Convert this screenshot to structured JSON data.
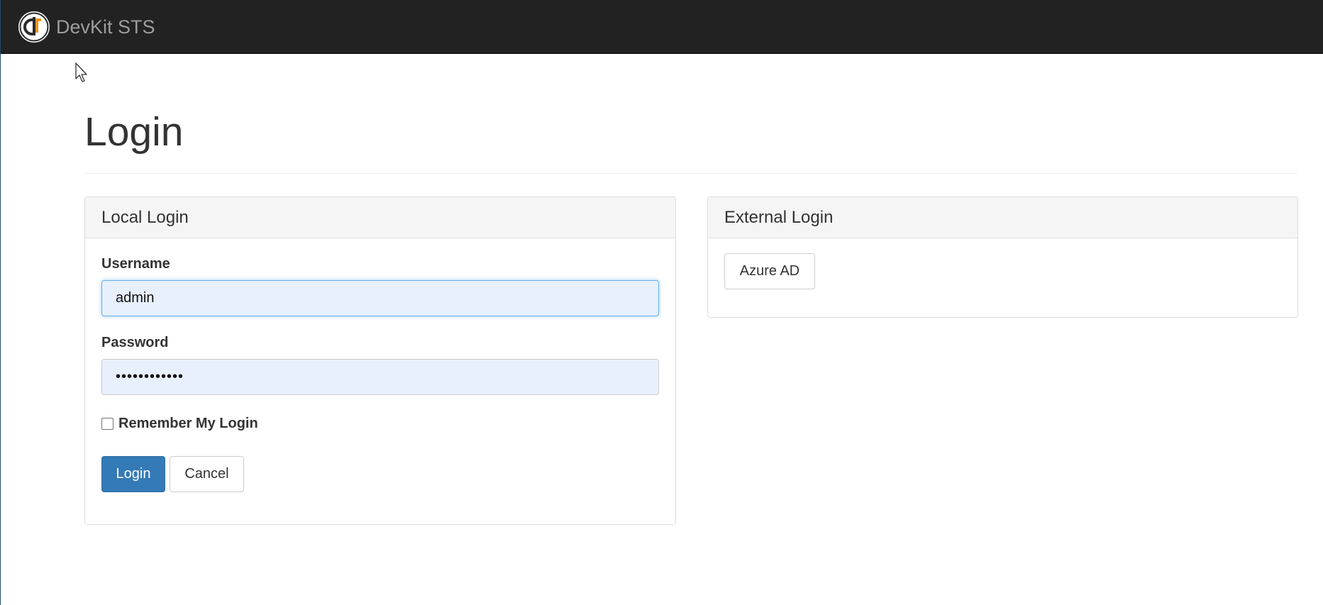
{
  "navbar": {
    "brand_name": "DevKit STS",
    "logo_icon": "devkit-logo-icon",
    "background": "#222222",
    "brand_color": "#9d9d9d"
  },
  "page": {
    "title": "Login"
  },
  "local_login": {
    "heading": "Local Login",
    "username_label": "Username",
    "username_value": "admin",
    "password_label": "Password",
    "password_value": "••••••••••••",
    "remember_label": "Remember My Login",
    "remember_checked": false,
    "login_button": "Login",
    "cancel_button": "Cancel"
  },
  "external_login": {
    "heading": "External Login",
    "providers": [
      {
        "label": "Azure AD"
      }
    ]
  },
  "colors": {
    "primary": "#337ab7",
    "input_autofill": "#e8f0fe",
    "focus_border": "#66afe9",
    "panel_heading_bg": "#f5f5f5"
  }
}
